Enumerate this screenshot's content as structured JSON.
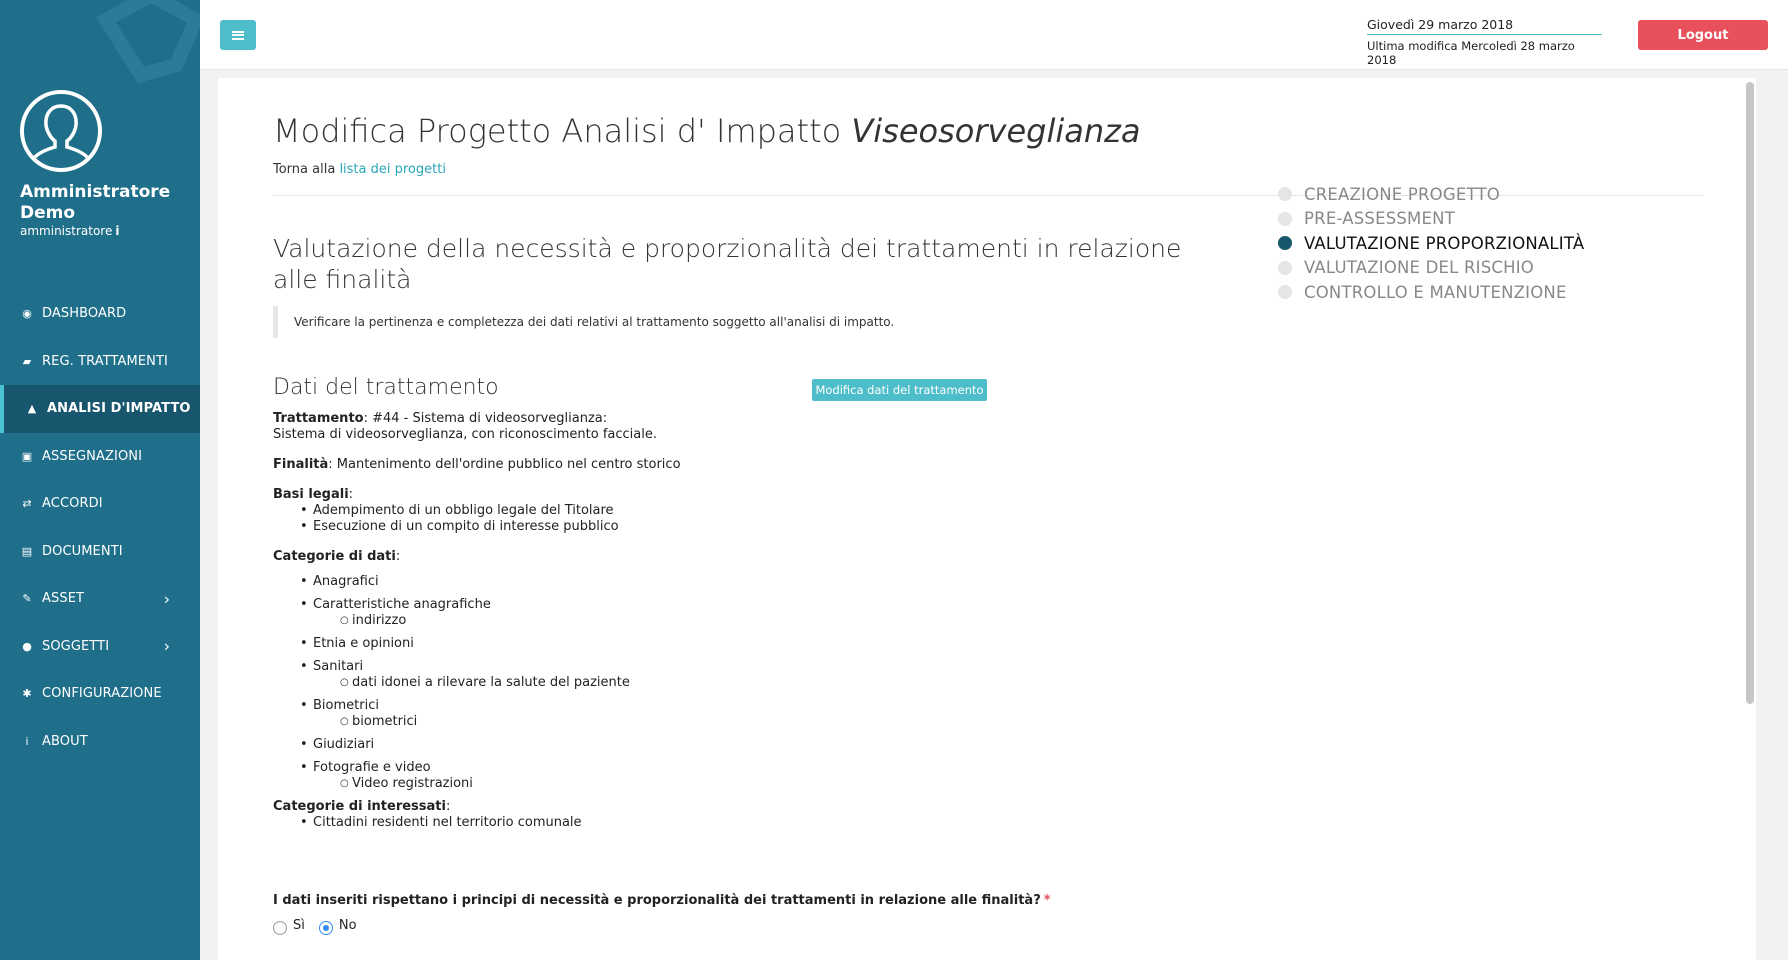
{
  "sidebar": {
    "user": {
      "name": "Amministratore Demo",
      "role": "amministratore",
      "role_info": "i"
    },
    "items": [
      {
        "label": "DASHBOARD",
        "icon": "dashboard-icon",
        "active": false
      },
      {
        "label": "REG. TRATTAMENTI",
        "icon": "book-icon",
        "active": false
      },
      {
        "label": "ANALISI D'IMPATTO",
        "icon": "warning-icon",
        "active": true
      },
      {
        "label": "ASSEGNAZIONI",
        "icon": "badge-icon",
        "active": false
      },
      {
        "label": "ACCORDI",
        "icon": "handshake-icon",
        "active": false
      },
      {
        "label": "DOCUMENTI",
        "icon": "document-icon",
        "active": false
      },
      {
        "label": "ASSET",
        "icon": "edit-icon",
        "active": false,
        "chevron": "›"
      },
      {
        "label": "SOGGETTI",
        "icon": "users-icon",
        "active": false,
        "chevron": "›"
      },
      {
        "label": "CONFIGURAZIONE",
        "icon": "gear-icon",
        "active": false
      },
      {
        "label": "ABOUT",
        "icon": "info-icon",
        "active": false
      }
    ]
  },
  "topbar": {
    "date_today": "Giovedì 29 marzo 2018",
    "last_modified": "Ultima modifica Mercoledì 28 marzo 2018",
    "logout_label": "Logout"
  },
  "page": {
    "title_prefix": "Modifica Progetto Analisi d' Impatto ",
    "title_project": "Viseosorveglianza",
    "back_prefix": "Torna alla ",
    "back_link": "lista dei progetti",
    "section_title": "Valutazione della necessità e proporzionalità dei trattamenti in relazione alle finalità",
    "callout": "Verificare la pertinenza e completezza dei dati relativi al trattamento soggetto all'analisi di impatto.",
    "subsection_title": "Dati del trattamento",
    "edit_button": "Modifica dati del trattamento"
  },
  "details": {
    "trattamento_label": "Trattamento",
    "trattamento_value": ": #44 - Sistema di videosorveglianza:",
    "trattamento_desc": "Sistema di videosorveglianza, con riconoscimento facciale.",
    "finalita_label": "Finalità",
    "finalita_value": ": Mantenimento dell'ordine pubblico nel centro storico",
    "basi_label": "Basi legali",
    "basi": [
      "Adempimento di un obbligo legale del Titolare",
      "Esecuzione di un compito di interesse pubblico"
    ],
    "categorie_label": "Categorie di dati",
    "categorie": [
      {
        "name": "Anagrafici",
        "sub": []
      },
      {
        "name": "Caratteristiche anagrafiche",
        "sub": [
          "indirizzo"
        ]
      },
      {
        "name": "Etnia e opinioni",
        "sub": []
      },
      {
        "name": "Sanitari",
        "sub": [
          "dati idonei a rilevare la salute del paziente"
        ]
      },
      {
        "name": "Biometrici",
        "sub": [
          "biometrici"
        ]
      },
      {
        "name": "Giudiziari",
        "sub": []
      },
      {
        "name": "Fotografie e video",
        "sub": [
          "Video registrazioni"
        ]
      }
    ],
    "interessati_label": "Categorie di interessati",
    "interessati": [
      "Cittadini residenti nel territorio comunale"
    ],
    "colon": ":"
  },
  "question": {
    "text": "I dati inseriti rispettano i principi di necessità e proporzionalità dei trattamenti in relazione alle finalità?",
    "required_mark": "*",
    "options": [
      "Sì",
      "No"
    ],
    "selected": "No"
  },
  "steps": [
    {
      "label": "CREAZIONE PROGETTO",
      "active": false
    },
    {
      "label": "PRE-ASSESSMENT",
      "active": false
    },
    {
      "label": "VALUTAZIONE PROPORZIONALITÀ",
      "active": true
    },
    {
      "label": "VALUTAZIONE DEL RISCHIO",
      "active": false
    },
    {
      "label": "CONTROLLO E MANUTENZIONE",
      "active": false
    }
  ],
  "colors": {
    "sidebar": "#1f6f8b",
    "accent": "#4cbdc9",
    "danger": "#e8505b",
    "step_active": "#17566d"
  }
}
